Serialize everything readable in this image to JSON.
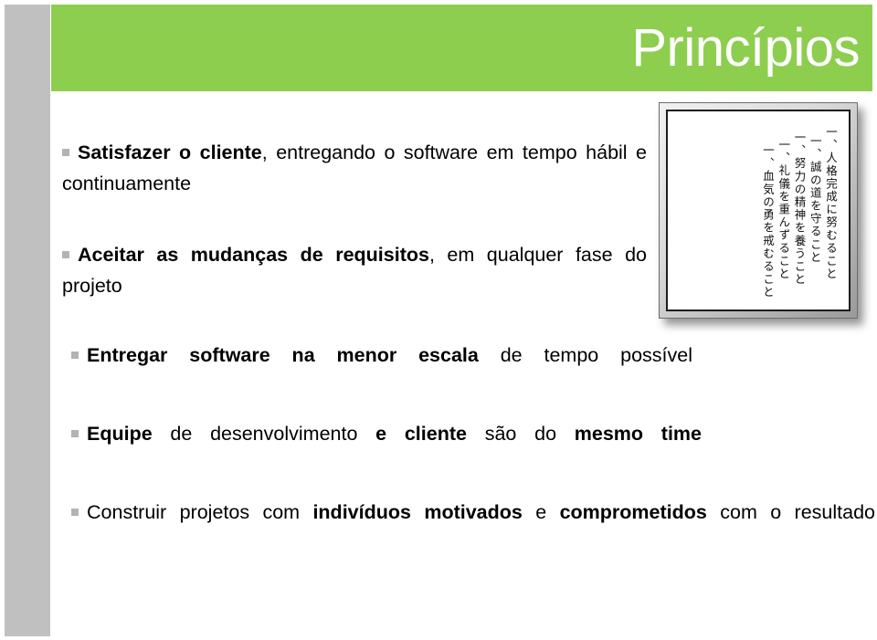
{
  "slide": {
    "title": "Princípios",
    "theme": {
      "accent_green": "#8DCE4F",
      "sidebar_gray": "#C0C0C0",
      "title_color": "#FFFFFF",
      "body_text_color": "#000000",
      "bullet_marker_color": "#B3B3B3"
    }
  },
  "bullets": [
    {
      "marker": "square-bullet",
      "bold_lead": "Satisfazer o cliente",
      "rest": ", entregando o software em tempo hábil e continuamente",
      "full_text": "Satisfazer o cliente, entregando o software em tempo hábil e continuamente"
    },
    {
      "marker": "square-bullet",
      "bold_lead": "Aceitar as mudanças de requisitos",
      "rest": ", em qualquer fase do projeto",
      "full_text": "Aceitar as mudanças de requisitos, em qualquer fase do projeto"
    },
    {
      "marker": "square-bullet",
      "bold_lead": "Entregar software na menor escala",
      "rest": " de tempo possível",
      "full_text": "Entregar software na menor escala de tempo possível"
    },
    {
      "marker": "square-bullet",
      "segment_1_bold": "Equipe",
      "segment_2": " de desenvolvimento ",
      "segment_3_bold": "e cliente",
      "segment_4": " são do ",
      "segment_5_bold": "mesmo time",
      "full_text": "Equipe de desenvolvimento e cliente são do mesmo time"
    },
    {
      "marker": "square-bullet",
      "segment_1": "Construir projetos com ",
      "segment_2_bold": "indivíduos motivados",
      "segment_3": " e ",
      "segment_4_bold": "comprometidos",
      "segment_5": " com o resultado",
      "full_text": "Construir projetos com indivíduos motivados e comprometidos com o resultado"
    }
  ],
  "picture": {
    "caption_kind": "framed-japanese-dojo-kun-scroll",
    "lines": [
      "一、人格完成に努むること",
      "一、誠の道を守ること",
      "一、努力の精神を養うこと",
      "一、礼儀を重んずること",
      "一、血気の勇を戒むること"
    ]
  }
}
